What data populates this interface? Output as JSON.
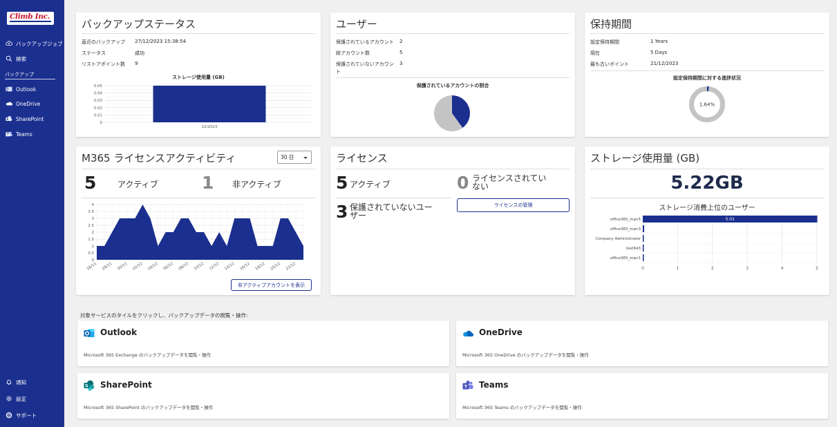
{
  "brand": {
    "logo_text": "Climb Inc."
  },
  "sidebar": {
    "items_top": [
      {
        "label": "バックアップジョブ",
        "icon": "cloud-upload-icon"
      },
      {
        "label": "検索",
        "icon": "search-icon"
      }
    ],
    "section_label": "バックアップ",
    "services": [
      {
        "label": "Outlook",
        "icon": "outlook-icon"
      },
      {
        "label": "OneDrive",
        "icon": "onedrive-icon"
      },
      {
        "label": "SharePoint",
        "icon": "sharepoint-icon"
      },
      {
        "label": "Teams",
        "icon": "teams-icon"
      }
    ],
    "items_bottom": [
      {
        "label": "通知",
        "icon": "bell-icon"
      },
      {
        "label": "設定",
        "icon": "gear-icon"
      },
      {
        "label": "サポート",
        "icon": "support-icon"
      }
    ]
  },
  "backup_status": {
    "title": "バックアップステータス",
    "rows": [
      {
        "label": "直近のバックアップ",
        "value": "27/12/2023 15:38:54"
      },
      {
        "label": "ステータス",
        "value": "成功"
      },
      {
        "label": "リストアポイント数",
        "value": "9"
      }
    ]
  },
  "users": {
    "title": "ユーザー",
    "rows": [
      {
        "label": "保護されているアカウント",
        "value": "2"
      },
      {
        "label": "総アカウント数",
        "value": "5"
      },
      {
        "label": "保護されていないアカウント",
        "value": "3"
      }
    ]
  },
  "retention": {
    "title": "保持期間",
    "rows": [
      {
        "label": "設定保持期間",
        "value": "1 Years"
      },
      {
        "label": "現在",
        "value": "5 Days"
      },
      {
        "label": "最も古いポイント",
        "value": "21/12/2023"
      }
    ]
  },
  "license_activity": {
    "title": "M365 ライセンスアクティビティ",
    "period": "30 日",
    "active_count": "5",
    "active_label": "アクティブ",
    "inactive_count": "1",
    "inactive_label": "非アクティブ",
    "show_inactive_button": "非アクティブアカウントを表示"
  },
  "license": {
    "title": "ライセンス",
    "active_count": "5",
    "active_label": "アクティブ",
    "unlicensed_count": "0",
    "unlicensed_label": "ライセンスされていない",
    "unprotected_count": "3",
    "unprotected_label": "保護されていないユーザー",
    "manage_button": "ライセンスの管理"
  },
  "storage": {
    "title": "ストレージ使用量 (GB)",
    "total": "5.22GB"
  },
  "intro_text": "対象サービスのタイルをクリックし、バックアップデータの閲覧・操作:",
  "tiles": [
    {
      "name": "Outlook",
      "desc": "Microsoft 365 Exchange のバックアップデータを閲覧・操作",
      "icon": "outlook-icon"
    },
    {
      "name": "OneDrive",
      "desc": "Microsoft 365 OneDrive のバックアップデータを閲覧・操作",
      "icon": "onedrive-icon"
    },
    {
      "name": "SharePoint",
      "desc": "Microsoft 365 SharePoint のバックアップデータを閲覧・操作",
      "icon": "sharepoint-icon"
    },
    {
      "name": "Teams",
      "desc": "Microsoft 365 Teams のバックアップデータを閲覧・操作",
      "icon": "teams-icon"
    }
  ],
  "colors": {
    "sidebar": "#1b2f8f",
    "accent": "#1b2f8f",
    "pie_grey": "#c4c4c4"
  },
  "chart_data": [
    {
      "type": "bar",
      "title": "ストレージ使用量 (GB)",
      "categories": [
        "12/2023"
      ],
      "values": [
        0.05
      ],
      "ylim": [
        0,
        0.05
      ],
      "yticks": [
        "0",
        "0.01",
        "0.02",
        "0.03",
        "0.04",
        "0.05"
      ],
      "grid": true
    },
    {
      "type": "pie",
      "title": "保護されているアカウントの割合",
      "labels": [
        "保護されているアカウント",
        "保護されていないアカウント"
      ],
      "values": [
        2,
        3
      ]
    },
    {
      "type": "pie",
      "subtype": "donut",
      "title": "設定保持期間に対する進捗状況",
      "values": [
        1.64,
        98.36
      ],
      "center_label": "1.64%"
    },
    {
      "type": "area",
      "x": [
        "26/11",
        "27/11",
        "28/11",
        "29/11",
        "30/11",
        "01/12",
        "02/12",
        "03/12",
        "04/12",
        "05/12",
        "06/12",
        "07/12",
        "08/12",
        "09/12",
        "10/12",
        "11/12",
        "12/12",
        "13/12",
        "14/12",
        "15/12",
        "16/12",
        "17/12",
        "18/12",
        "19/12",
        "20/12",
        "21/12",
        "22/12",
        "23/12"
      ],
      "x_tick_labels": [
        "26/11",
        "28/11",
        "30/11",
        "02/12",
        "04/12",
        "06/12",
        "08/12",
        "10/12",
        "12/12",
        "14/12",
        "16/12",
        "18/12",
        "20/12",
        "22/12"
      ],
      "values": [
        1,
        1,
        2,
        3,
        3,
        3,
        4,
        3,
        1,
        2,
        2,
        3,
        3,
        2,
        2,
        1,
        2,
        1,
        3,
        3,
        3,
        1,
        1,
        1,
        3,
        3,
        2,
        1
      ],
      "ylim": [
        0,
        4
      ],
      "yticks": [
        "0",
        "0.5",
        "1",
        "1.5",
        "2",
        "2.5",
        "3",
        "3.5",
        "4"
      ],
      "grid": true
    },
    {
      "type": "bar",
      "orientation": "horizontal",
      "title": "ストレージ消費上位のユーザー",
      "categories": [
        "office365_mpn5",
        "office365_mpn3",
        "Company Administrator",
        "test643",
        "office365_mpn1"
      ],
      "values": [
        5.01,
        0.04,
        0.03,
        0.02,
        0.01
      ],
      "data_labels": [
        "5.01",
        "",
        "",
        "",
        ""
      ],
      "xlim": [
        0,
        5
      ],
      "xticks": [
        "0",
        "1",
        "2",
        "3",
        "4",
        "5"
      ],
      "grid": true
    }
  ]
}
